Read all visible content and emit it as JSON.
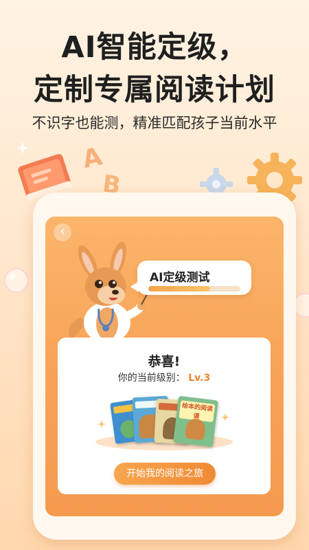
{
  "header": {
    "line1": "AI智能定级，",
    "line2": "定制专属阅读计划",
    "subtitle": "不识字也能测，精准匹配孩子当前水平"
  },
  "screen": {
    "back_icon": "chevron-left-icon",
    "bubble": {
      "title": "AI定级测试",
      "progress_fraction": 0.67
    },
    "result_card": {
      "congrats": "恭喜!",
      "level_label": "你的当前级别：",
      "level_value": "Lv.3",
      "books": [
        "",
        "",
        "",
        "绘本的阅读课"
      ],
      "start_button": "开始我的阅读之旅"
    }
  },
  "colors": {
    "accent": "#f59a4e",
    "level_text": "#e8852a"
  }
}
